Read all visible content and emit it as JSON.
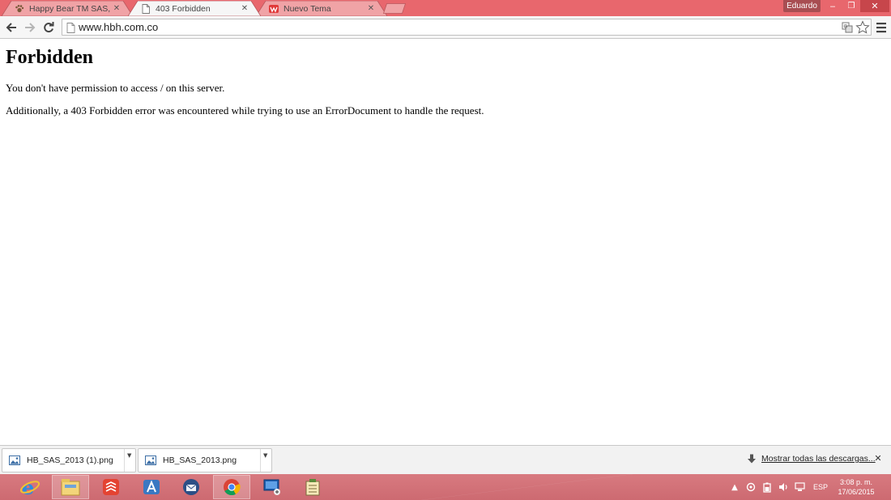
{
  "browser": {
    "tabs": [
      {
        "title": "Happy Bear TM SAS, Toall",
        "icon": "bear-paw-icon",
        "active": false
      },
      {
        "title": "403 Forbidden",
        "icon": "page-icon",
        "active": true
      },
      {
        "title": "Nuevo Tema",
        "icon": "w-logo-icon",
        "active": false
      }
    ],
    "user_name": "Eduardo",
    "address": "www.hbh.com.co",
    "colors": {
      "frame": "#e8676d",
      "active_tab": "#f6f6f6",
      "inactive_tab": "#f0a3a6",
      "close_button": "#c7464b"
    }
  },
  "page": {
    "heading": "Forbidden",
    "paragraphs": [
      "You don't have permission to access / on this server.",
      "Additionally, a 403 Forbidden error was encountered while trying to use an ErrorDocument to handle the request."
    ]
  },
  "downloads": {
    "items": [
      {
        "name": "HB_SAS_2013 (1).png",
        "icon": "image-file-icon"
      },
      {
        "name": "HB_SAS_2013.png",
        "icon": "image-file-icon"
      }
    ],
    "show_all_label": "Mostrar todas las descargas..."
  },
  "taskbar": {
    "apps": [
      "internet-explorer",
      "file-explorer",
      "todoist",
      "app-store",
      "thunderbird",
      "chrome",
      "remote-desktop",
      "archive"
    ],
    "active_app": "chrome",
    "tray_language": "ESP",
    "clock_time": "3:08 p. m.",
    "clock_date": "17/06/2015",
    "color": "#d2737a"
  }
}
